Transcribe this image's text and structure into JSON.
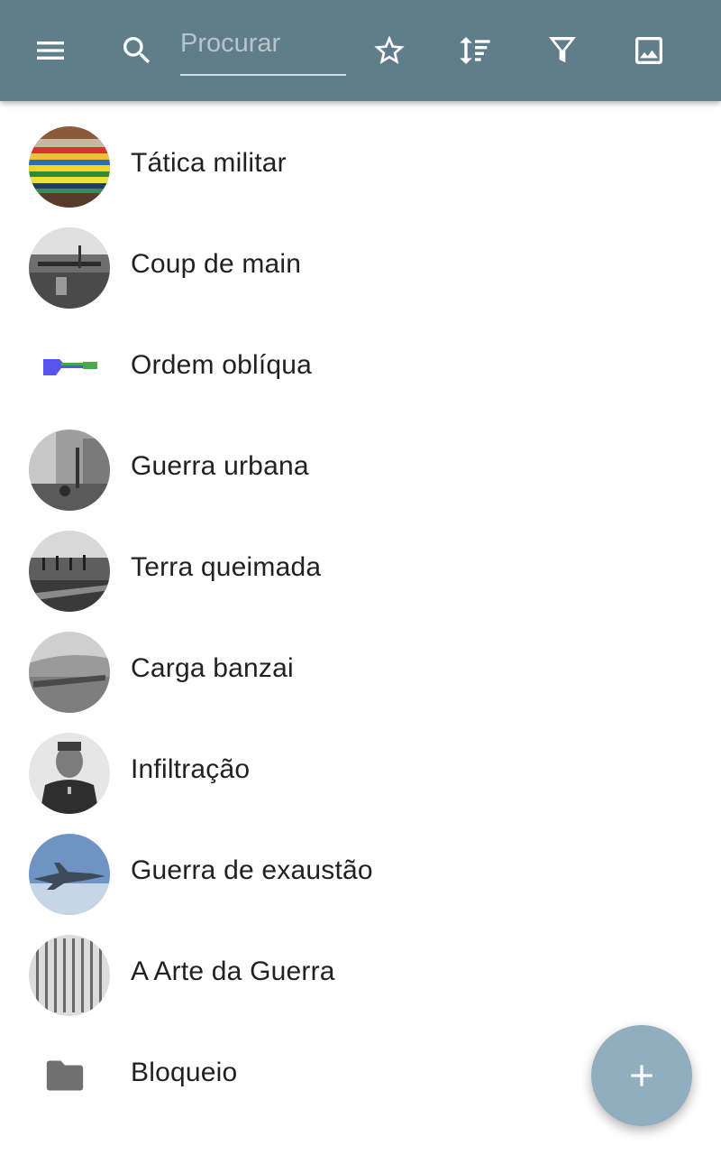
{
  "appbar": {
    "background_color": "#607d8b",
    "menu_icon": "menu-icon",
    "search_icon": "search-icon",
    "search_placeholder": "Procurar",
    "search_value": "",
    "favorite_icon": "star-outline-icon",
    "sort_icon": "sort-icon",
    "filter_icon": "filter-icon",
    "image_icon": "image-icon"
  },
  "list": {
    "items": [
      {
        "label": "Tática militar",
        "thumbnail": "colored-books-photo"
      },
      {
        "label": "Coup de main",
        "thumbnail": "bw-bridge-photo"
      },
      {
        "label": "Ordem oblíqua",
        "thumbnail": "blue-green-diagram"
      },
      {
        "label": "Guerra urbana",
        "thumbnail": "bw-ruins-photo"
      },
      {
        "label": "Terra queimada",
        "thumbnail": "bw-crowd-photo"
      },
      {
        "label": "Carga banzai",
        "thumbnail": "bw-field-photo"
      },
      {
        "label": "Infiltração",
        "thumbnail": "bw-soldier-portrait"
      },
      {
        "label": "Guerra de exaustão",
        "thumbnail": "fighter-jet-photo"
      },
      {
        "label": "A Arte da Guerra",
        "thumbnail": "bamboo-text-photo"
      },
      {
        "label": "Bloqueio",
        "thumbnail": "folder-icon"
      }
    ]
  },
  "fab": {
    "icon": "plus-icon",
    "color": "#90aebd"
  }
}
